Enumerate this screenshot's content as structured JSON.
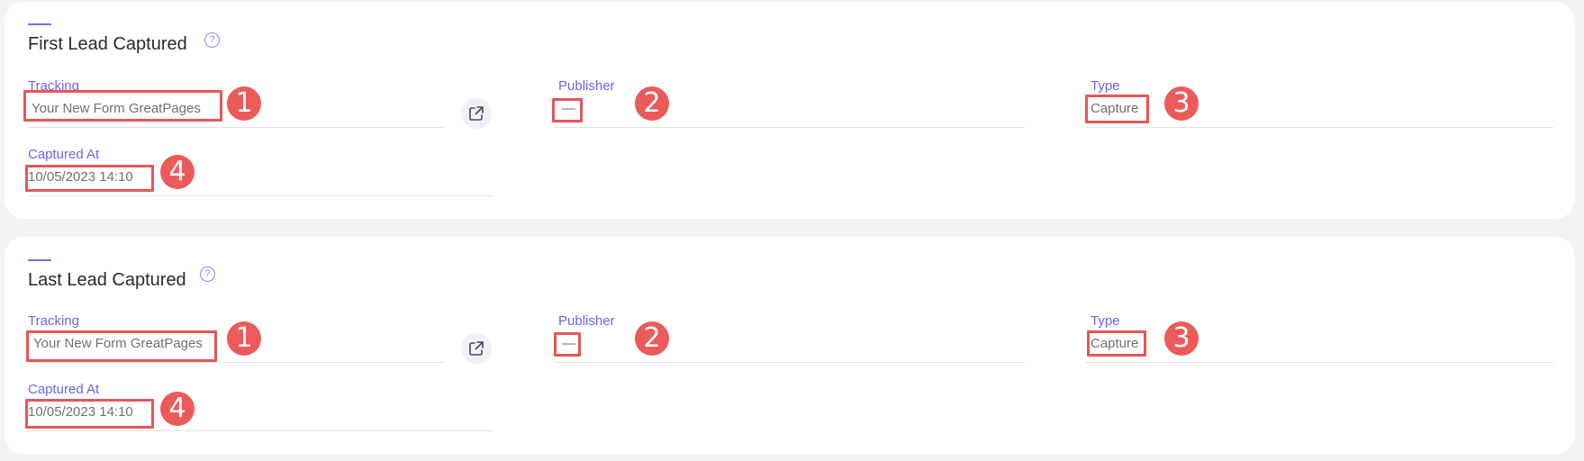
{
  "first_card": {
    "title": "First Lead Captured",
    "help_icon": "question-circle-icon",
    "tracking": {
      "label": "Tracking",
      "value": "Your New Form  GreatPages"
    },
    "publisher": {
      "label": "Publisher",
      "value": "—"
    },
    "type": {
      "label": "Type",
      "value": "Capture"
    },
    "captured_at": {
      "label": "Captured At",
      "value": "10/05/2023 14:10"
    },
    "open_link_icon": "external-link-icon"
  },
  "last_card": {
    "title": "Last Lead Captured",
    "help_icon": "question-circle-icon",
    "tracking": {
      "label": "Tracking",
      "value": "Your New Form GreatPages"
    },
    "publisher": {
      "label": "Publisher",
      "value": "—"
    },
    "type": {
      "label": "Type",
      "value": "Capture"
    },
    "captured_at": {
      "label": "Captured At",
      "value": "10/05/2023 14:10"
    },
    "open_link_icon": "external-link-icon"
  },
  "markers": [
    "1",
    "2",
    "3",
    "4"
  ],
  "colors": {
    "accent": "#6c63e8",
    "annotation_red": "#e85656",
    "background": "#f3f3f3",
    "card": "#ffffff"
  }
}
